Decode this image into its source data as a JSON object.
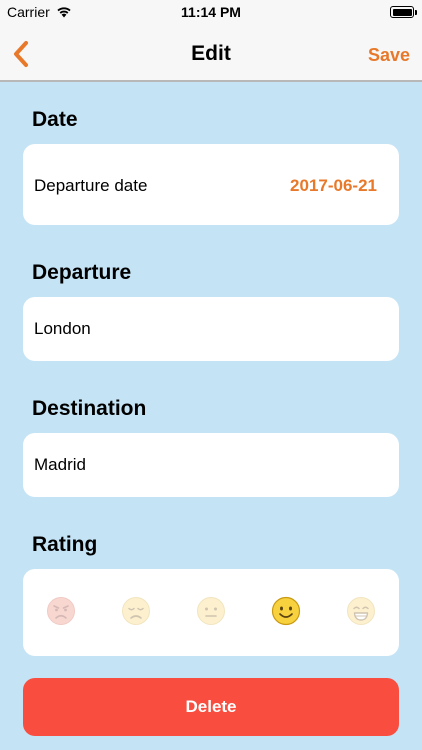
{
  "status_bar": {
    "carrier": "Carrier",
    "time": "11:14 PM"
  },
  "nav": {
    "title": "Edit",
    "save_label": "Save",
    "accent_color": "#e8792a"
  },
  "date_section": {
    "title": "Date",
    "field_label": "Departure date",
    "value": "2017-06-21"
  },
  "departure_section": {
    "title": "Departure",
    "value": "London"
  },
  "destination_section": {
    "title": "Destination",
    "value": "Madrid"
  },
  "rating_section": {
    "title": "Rating",
    "options": [
      "angry-face-icon",
      "sad-face-icon",
      "neutral-face-icon",
      "smiling-face-icon",
      "grinning-face-icon"
    ],
    "selected_index": 3
  },
  "delete_button": {
    "label": "Delete",
    "color": "#f94e3f"
  }
}
